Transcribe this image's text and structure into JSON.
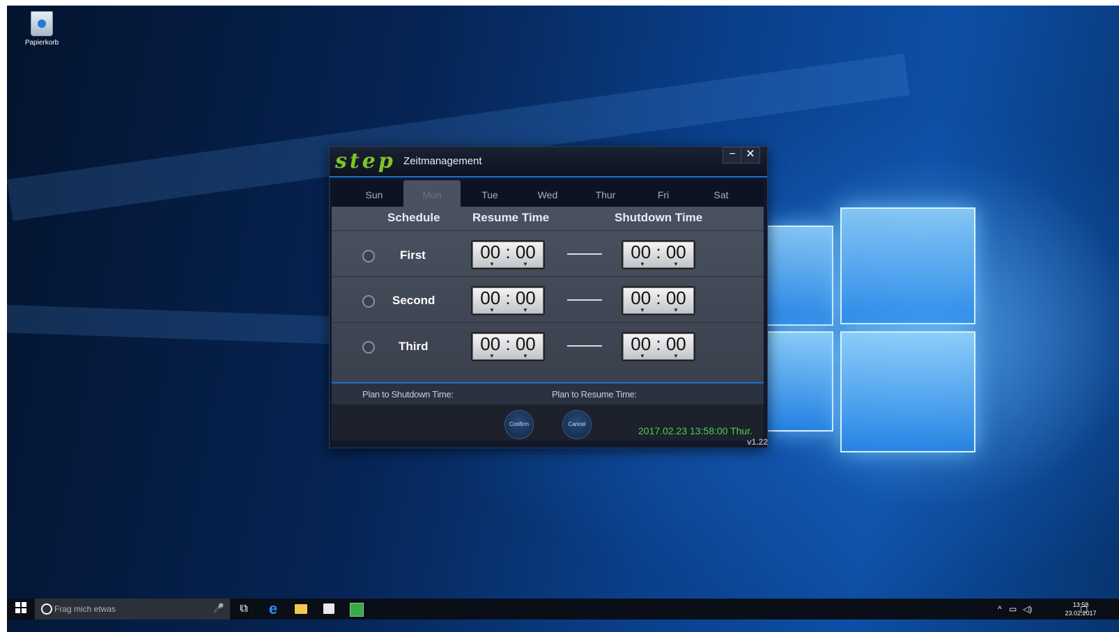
{
  "desktop": {
    "recycle_bin_label": "Papierkorb"
  },
  "app": {
    "brand": "step",
    "title": "Zeitmanagement",
    "minimize_label": "−",
    "close_label": "✕",
    "tabs": [
      "Sun",
      "Mon",
      "Tue",
      "Wed",
      "Thur",
      "Fri",
      "Sat"
    ],
    "active_tab": "Mon",
    "columns": {
      "schedule": "Schedule",
      "resume": "Resume Time",
      "shutdown": "Shutdown Time"
    },
    "rows": [
      {
        "label": "First",
        "resume": "00 : 00",
        "shutdown": "00 : 00"
      },
      {
        "label": "Second",
        "resume": "00 : 00",
        "shutdown": "00 : 00"
      },
      {
        "label": "Third",
        "resume": "00 : 00",
        "shutdown": "00 : 00"
      }
    ],
    "plan_shutdown_label": "Plan to Shutdown Time:",
    "plan_resume_label": "Plan to Resume Time:",
    "confirm_label": "Confirm",
    "cancel_label": "Cancel",
    "datetime": "2017.02.23   13:58:00   Thur.",
    "version": "v1.22",
    "colors": {
      "brand": "#7fc424",
      "clock_text": "#4bd24b",
      "accent": "#1f6fd0"
    }
  },
  "taskbar": {
    "search_placeholder": "Frag mich etwas",
    "time": "13:58",
    "date": "23.02.2017"
  }
}
